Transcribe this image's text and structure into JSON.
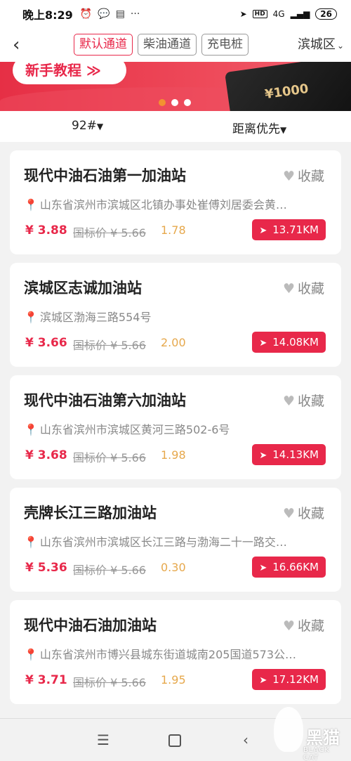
{
  "status": {
    "time": "晚上8:29",
    "signal": "4G",
    "battery": "26"
  },
  "nav": {
    "tabs": [
      {
        "label": "默认通道",
        "active": true
      },
      {
        "label": "柴油通道",
        "active": false
      },
      {
        "label": "充电桩",
        "active": false
      }
    ],
    "city": "滨城区"
  },
  "banner": {
    "tutorial_label": "新手教程 ≫",
    "card_value": "¥1000",
    "active_dot": 0,
    "dot_count": 3
  },
  "filters": {
    "fuel": "92#",
    "sort": "距离优先"
  },
  "fav_label": "收藏",
  "stations": [
    {
      "name": "现代中油石油第一加油站",
      "address": "山东省滨州市滨城区北镇办事处崔傅刘居委会黄…",
      "price": "¥ 3.88",
      "national": "国标价 ¥ 5.66",
      "discount": "1.78",
      "distance": "13.71KM"
    },
    {
      "name": "滨城区志诚加油站",
      "address": "滨城区渤海三路554号",
      "price": "¥ 3.66",
      "national": "国标价 ¥ 5.66",
      "discount": "2.00",
      "distance": "14.08KM"
    },
    {
      "name": "现代中油石油第六加油站",
      "address": "山东省滨州市滨城区黄河三路502-6号",
      "price": "¥ 3.68",
      "national": "国标价 ¥ 5.66",
      "discount": "1.98",
      "distance": "14.13KM"
    },
    {
      "name": "壳牌长江三路加油站",
      "address": "山东省滨州市滨城区长江三路与渤海二十一路交…",
      "price": "¥ 5.36",
      "national": "国标价 ¥ 5.66",
      "discount": "0.30",
      "distance": "16.66KM"
    },
    {
      "name": "现代中油石油加油站",
      "address": "山东省滨州市博兴县城东街道城南205国道573公…",
      "price": "¥ 3.71",
      "national": "国标价 ¥ 5.66",
      "discount": "1.95",
      "distance": "17.12KM"
    }
  ],
  "watermark": {
    "big": "黑猫",
    "small": "BLACK CAT"
  },
  "colors": {
    "accent": "#e8284a",
    "discount": "#e6a84c",
    "pin": "#4a8fe0",
    "dot_active": "#f39230"
  }
}
